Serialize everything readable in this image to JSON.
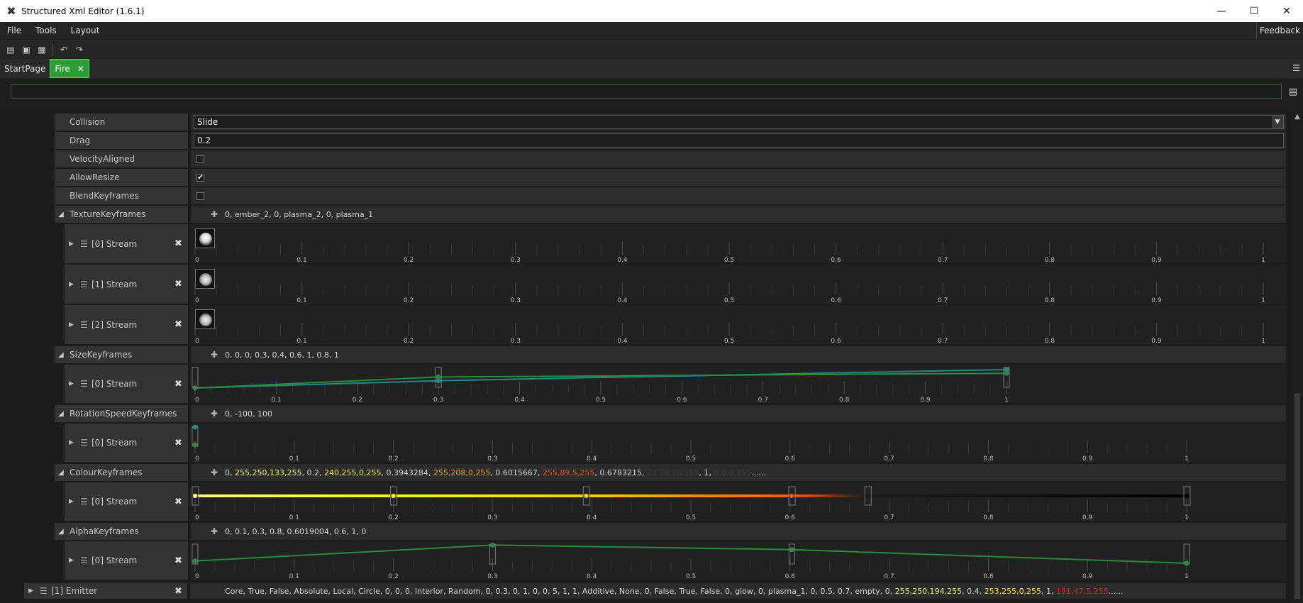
{
  "window": {
    "title": "Structured Xml Editor (1.6.1)",
    "minimize": "—",
    "maximize": "☐",
    "close": "✕"
  },
  "menu": {
    "file": "File",
    "tools": "Tools",
    "layout": "Layout",
    "feedback": "Feedback"
  },
  "tabs": [
    {
      "label": "StartPage"
    },
    {
      "label": "Fire",
      "close": "✕"
    }
  ],
  "filter": {
    "value": ""
  },
  "properties": {
    "collision": {
      "label": "Collision",
      "value": "Slide"
    },
    "drag": {
      "label": "Drag",
      "value": "0.2"
    },
    "velocity_aligned": {
      "label": "VelocityAligned",
      "checked": false
    },
    "allow_resize": {
      "label": "AllowResize",
      "checked": true
    },
    "blend_keyframes": {
      "label": "BlendKeyframes",
      "checked": false
    }
  },
  "texture_keyframes": {
    "label": "TextureKeyframes",
    "summary": "0, ember_2, 0, plasma_2, 0, plasma_1",
    "streams": [
      {
        "label": "[0] Stream"
      },
      {
        "label": "[1] Stream"
      },
      {
        "label": "[2] Stream"
      }
    ]
  },
  "size_keyframes": {
    "label": "SizeKeyframes",
    "summary": "0, 0, 0, 0.3, 0.4, 0.6, 1, 0.8, 1",
    "stream": "[0] Stream"
  },
  "rotation_keyframes": {
    "label": "RotationSpeedKeyframes",
    "summary": "0, -100, 100",
    "stream": "[0] Stream"
  },
  "colour_keyframes": {
    "label": "ColourKeyframes",
    "summary_parts": [
      {
        "text": "0, ",
        "color": "white"
      },
      {
        "text": "255,250,133,255",
        "color": "yellow"
      },
      {
        "text": ", 0.2, ",
        "color": "white"
      },
      {
        "text": "240,255,0,255",
        "color": "yellow2"
      },
      {
        "text": ", 0.3943284, ",
        "color": "white"
      },
      {
        "text": "255,208,0,255",
        "color": "orange"
      },
      {
        "text": ", 0.6015667, ",
        "color": "white"
      },
      {
        "text": "255,89,5,255",
        "color": "red"
      },
      {
        "text": ", 0.6783215, ",
        "color": "white"
      },
      {
        "text": "28,28,28,255",
        "color": "dark"
      },
      {
        "text": ", 1, ",
        "color": "white"
      },
      {
        "text": "0,0,0,255",
        "color": "dark"
      },
      {
        "text": "......",
        "color": "white"
      }
    ],
    "stream": "[0] Stream"
  },
  "alpha_keyframes": {
    "label": "AlphaKeyframes",
    "summary": "0, 0.1, 0.3, 0.8, 0.6019004, 0.6, 1, 0",
    "stream": "[0] Stream"
  },
  "emitter": {
    "label": "[1] Emitter",
    "summary_parts": [
      {
        "text": "Core, True, False, Absolute, Local, Circle, 0, 0, 0, Interior, Random, 0, 0.3, 0, 1, 0, 0, 5, 1, 1, Additive, None, 0, False, True, False, 0, glow, 0, plasma_1, 0, 0.5, 0.7, empty, 0, ",
        "color": "white"
      },
      {
        "text": "255,250,194,255",
        "color": "yellow"
      },
      {
        "text": ", 0.4, ",
        "color": "white"
      },
      {
        "text": "253,255,0,255",
        "color": "yellow2"
      },
      {
        "text": ", 1, ",
        "color": "white"
      },
      {
        "text": "181,47,5,255",
        "color": "red2"
      },
      {
        "text": "......",
        "color": "white"
      }
    ]
  },
  "axis_ticks": [
    "0",
    "0.1",
    "0.2",
    "0.3",
    "0.4",
    "0.5",
    "0.6",
    "0.7",
    "0.8",
    "0.9",
    "1"
  ],
  "size_curve": {
    "series": [
      {
        "x": [
          0,
          0.3,
          1
        ],
        "y": [
          0,
          0.4,
          1
        ]
      },
      {
        "x": [
          0,
          0.3,
          1
        ],
        "y": [
          0,
          0.6,
          0.8
        ]
      }
    ]
  },
  "rotation_curve": {
    "x": [
      0,
      0
    ],
    "y": [
      -100,
      100
    ]
  },
  "colour_stops": [
    {
      "t": 0,
      "color": "#fffa85"
    },
    {
      "t": 0.2,
      "color": "#f0ff00"
    },
    {
      "t": 0.3943284,
      "color": "#ffd000"
    },
    {
      "t": 0.6015667,
      "color": "#ff5905"
    },
    {
      "t": 0.6783215,
      "color": "#1c1c1c"
    },
    {
      "t": 1,
      "color": "#000000"
    }
  ],
  "alpha_curve": {
    "x": [
      0,
      0.3,
      0.6019004,
      1
    ],
    "y": [
      0.1,
      0.8,
      0.6,
      0
    ]
  }
}
